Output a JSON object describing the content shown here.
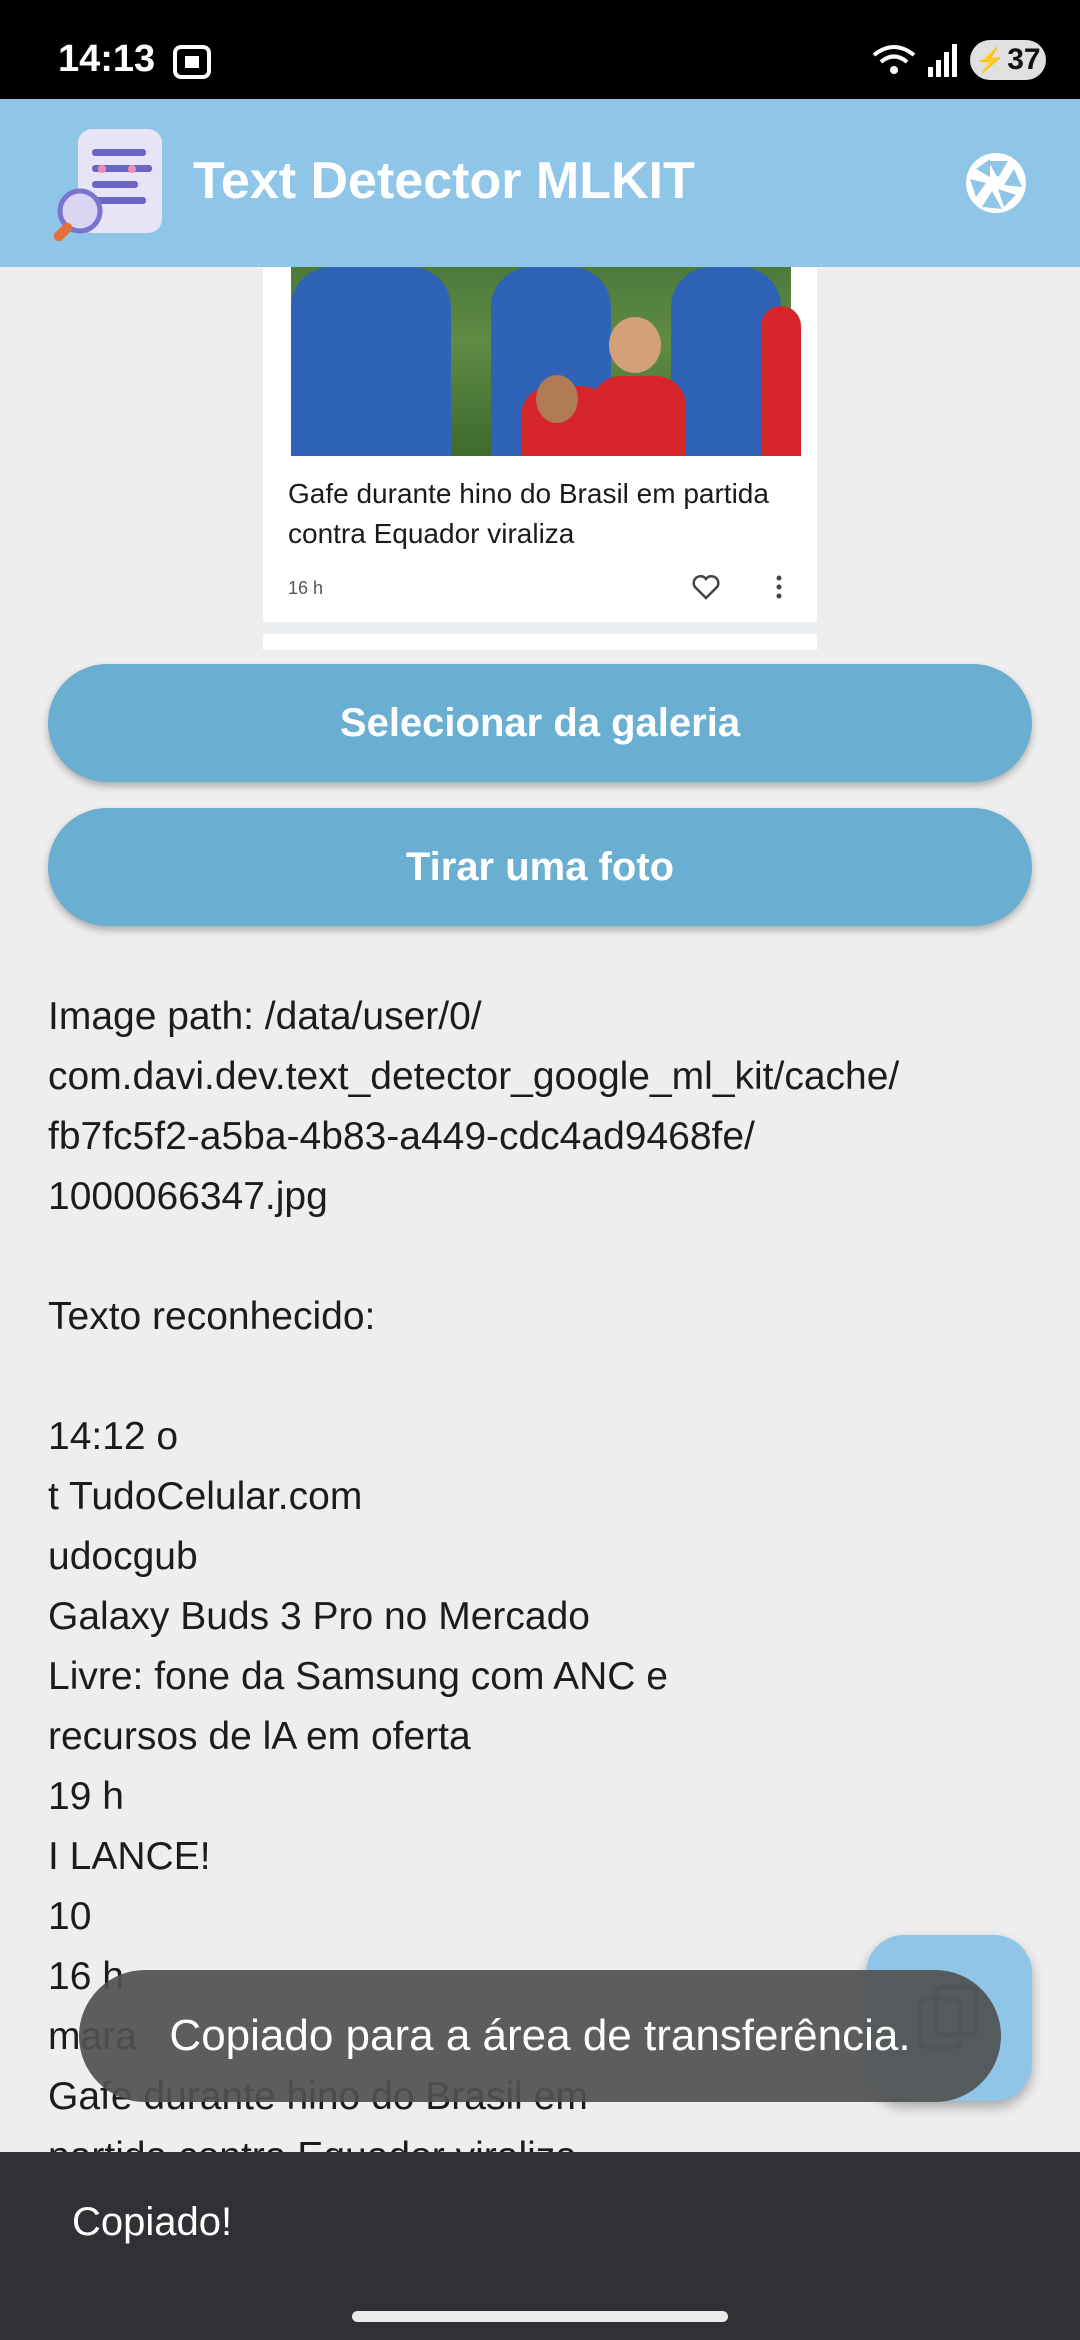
{
  "status_bar": {
    "time": "14:13",
    "battery": "37"
  },
  "app_bar": {
    "title": "Text Detector MLKIT"
  },
  "preview": {
    "caption": "Gafe durante hino do Brasil em partida contra Equador viraliza",
    "time": "16 h"
  },
  "buttons": {
    "gallery": "Selecionar da galeria",
    "photo": "Tirar uma foto"
  },
  "result": {
    "lines": [
      "Image path: /data/user/0/",
      "com.davi.dev.text_detector_google_ml_kit/cache/",
      "fb7fc5f2-a5ba-4b83-a449-cdc4ad9468fe/",
      "1000066347.jpg",
      "",
      "Texto reconhecido:",
      "",
      "14:12 o",
      "t TudoCelular.com",
      "udocgub",
      "Galaxy Buds 3 Pro no Mercado",
      "Livre: fone da Samsung com ANC e",
      "recursos de lA em oferta",
      "19 h",
      "I LANCE!",
      "10",
      "16 h",
      "mara",
      "Gafe durante hino do Brasil em",
      "partida contra Equador viraliza"
    ]
  },
  "toast": {
    "text": "Copiado para a área de transferência."
  },
  "snackbar": {
    "text": "Copiado!"
  },
  "colors": {
    "app_bar": "#8fc6e8",
    "button": "#6aaed1",
    "snackbar": "#323035"
  },
  "icons": {
    "action": "aperture-icon",
    "fab": "copy-icon",
    "logo": "document-search-logo"
  }
}
